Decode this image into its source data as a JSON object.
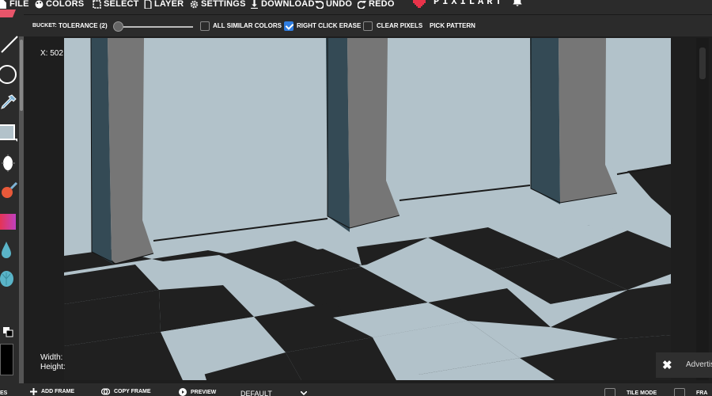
{
  "menu": {
    "file": "FILE",
    "colors": "COLORS",
    "select": "SELECT",
    "layer": "LAYER",
    "settings": "SETTINGS",
    "download": "DOWNLOAD",
    "undo": "UNDO",
    "redo": "REDO",
    "brand": "PIXILART",
    "brand_color": "#e8334a"
  },
  "toolbar": {
    "bucket_label": "BUCKET:",
    "tolerance_label": "TOLERANCE (2)",
    "tolerance_value": 2,
    "all_similar_colors": "ALL SIMILAR COLORS",
    "all_similar_colors_checked": false,
    "right_click_erase": "RIGHT CLICK ERASE",
    "right_click_erase_checked": true,
    "clear_pixels": "CLEAR PIXELS",
    "clear_pixels_checked": false,
    "pick_pattern": "PICK PATTERN"
  },
  "tools": [
    "eraser-icon",
    "line-icon",
    "circle-icon",
    "eyedropper-icon",
    "rectangle-icon",
    "bucket-icon",
    "lighten-icon",
    "gradient-icon",
    "blur-icon",
    "shell-icon"
  ],
  "canvas": {
    "coords_text": "X: 502",
    "width_label": "Width:",
    "height_label": "Height:",
    "colors": {
      "wall": "#b2c2ca",
      "pillar_shadow": "#344a55",
      "pillar_face": "#767676",
      "dark_tile": "#202020",
      "light_tile": "#b2c2ca"
    }
  },
  "ad": {
    "close": "✖",
    "label": "Advertis"
  },
  "bottom": {
    "es": "ES",
    "add_frame": "ADD FRAME",
    "copy_frame": "COPY FRAME",
    "preview": "PREVIEW",
    "default": "DEFAULT",
    "tile_mode": "TILE MODE",
    "fra": "FRA"
  }
}
